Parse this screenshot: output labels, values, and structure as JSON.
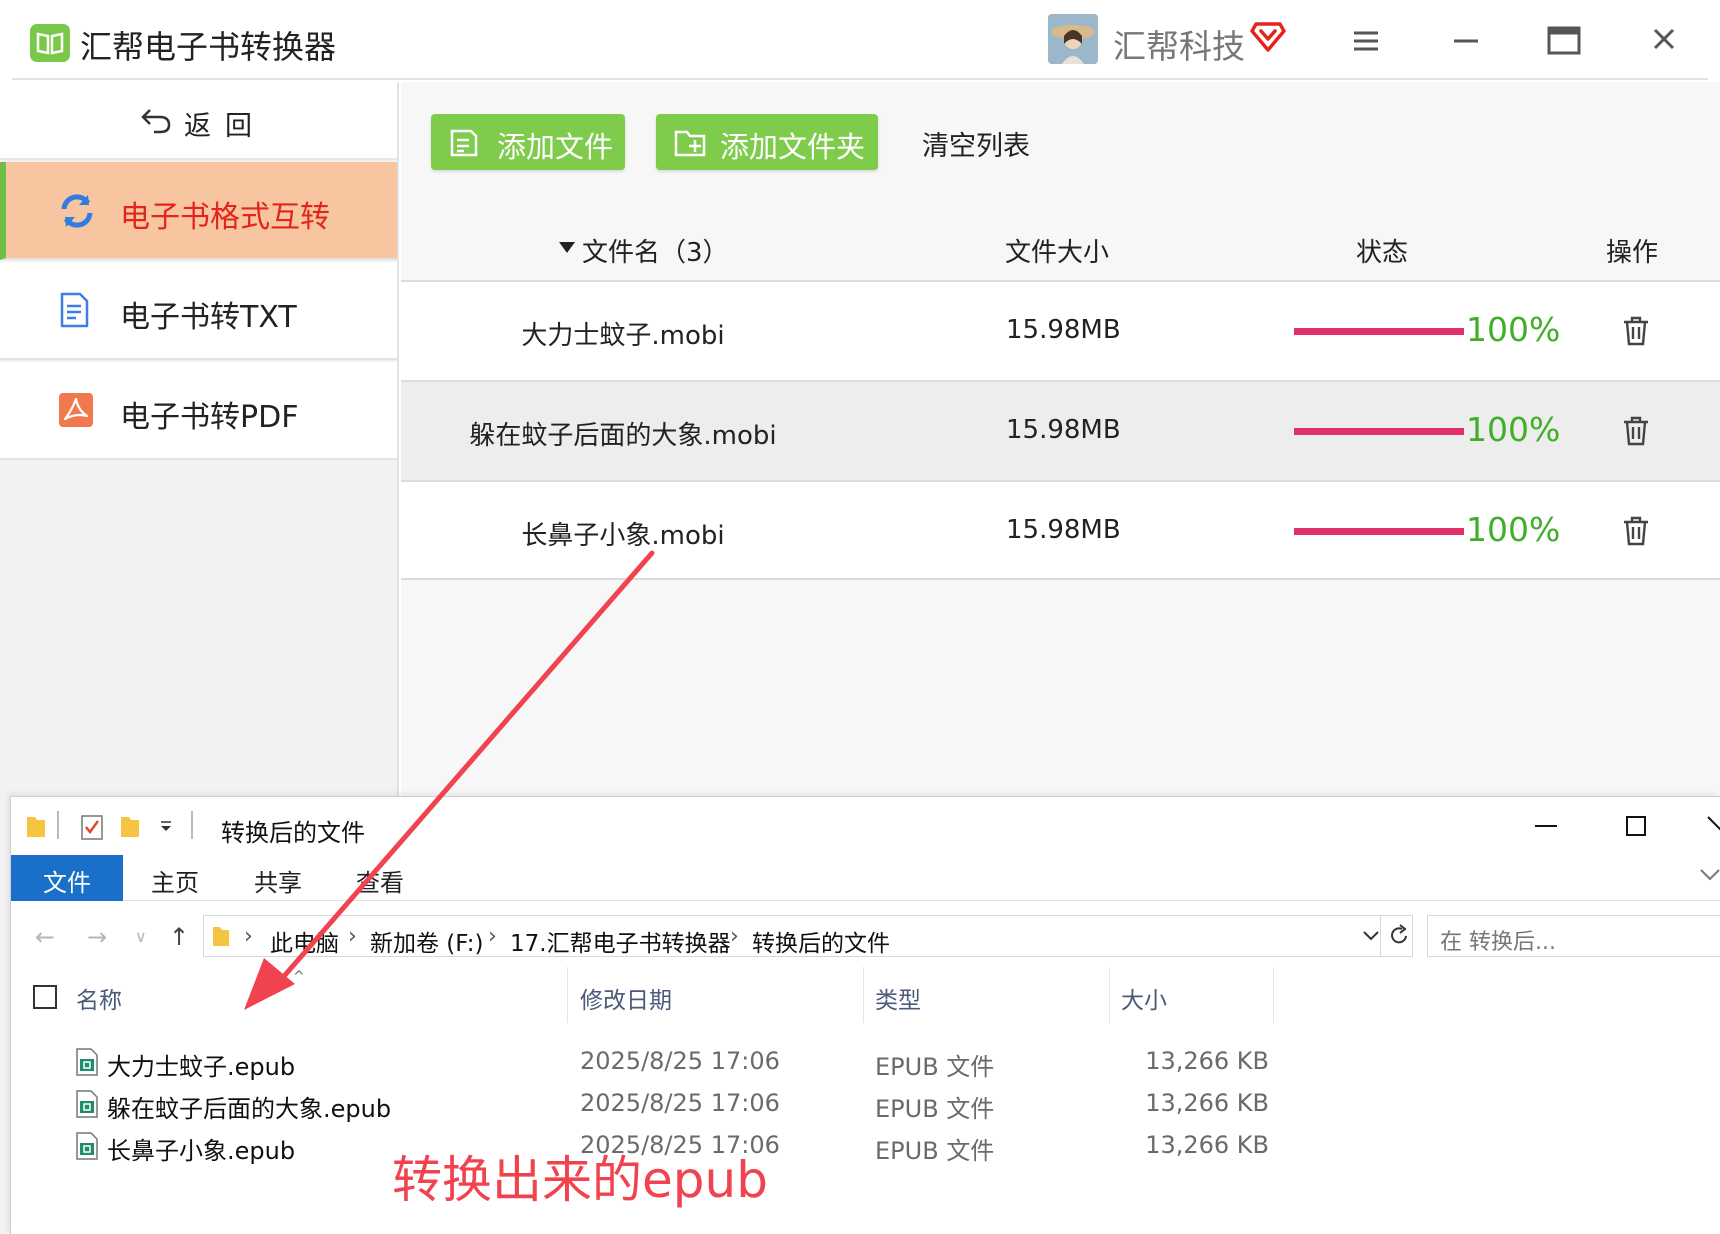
{
  "app": {
    "title": "汇帮电子书转换器",
    "company": "汇帮科技",
    "colors": {
      "accent_green": "#7fcb4b",
      "active_nav_bg": "#f7c6a0",
      "active_nav_text": "#e4241c",
      "progress_fill": "#e2306b",
      "percent_text": "#3fae29"
    }
  },
  "sidebar": {
    "back_label": "返回",
    "items": [
      {
        "label": "电子书格式互转",
        "icon": "refresh-icon",
        "active": true
      },
      {
        "label": "电子书转TXT",
        "icon": "txt-doc-icon",
        "active": false
      },
      {
        "label": "电子书转PDF",
        "icon": "pdf-icon",
        "active": false
      }
    ]
  },
  "toolbar": {
    "add_file": "添加文件",
    "add_folder": "添加文件夹",
    "clear_list": "清空列表"
  },
  "table": {
    "headers": {
      "name": "文件名（3）",
      "size": "文件大小",
      "status": "状态",
      "action": "操作"
    },
    "rows": [
      {
        "name": "大力士蚊子.mobi",
        "size": "15.98MB",
        "progress": 1.0,
        "percent": "100%"
      },
      {
        "name": "躲在蚊子后面的大象.mobi",
        "size": "15.98MB",
        "progress": 1.0,
        "percent": "100%"
      },
      {
        "name": "长鼻子小象.mobi",
        "size": "15.98MB",
        "progress": 1.0,
        "percent": "100%"
      }
    ]
  },
  "explorer": {
    "title": "转换后的文件",
    "ribbon": [
      "文件",
      "主页",
      "共享",
      "查看"
    ],
    "breadcrumb": [
      "此电脑",
      "新加卷 (F:)",
      "17.汇帮电子书转换器",
      "转换后的文件"
    ],
    "search_placeholder": "在 转换后...",
    "headers": {
      "name": "名称",
      "date": "修改日期",
      "type": "类型",
      "size": "大小"
    },
    "files": [
      {
        "name": "大力士蚊子.epub",
        "date": "2025/8/25 17:06",
        "type": "EPUB 文件",
        "size": "13,266 KB"
      },
      {
        "name": "躲在蚊子后面的大象.epub",
        "date": "2025/8/25 17:06",
        "type": "EPUB 文件",
        "size": "13,266 KB"
      },
      {
        "name": "长鼻子小象.epub",
        "date": "2025/8/25 17:06",
        "type": "EPUB 文件",
        "size": "13,266 KB"
      }
    ]
  },
  "annotation": {
    "text": "转换出来的epub",
    "color": "#f0434f"
  }
}
